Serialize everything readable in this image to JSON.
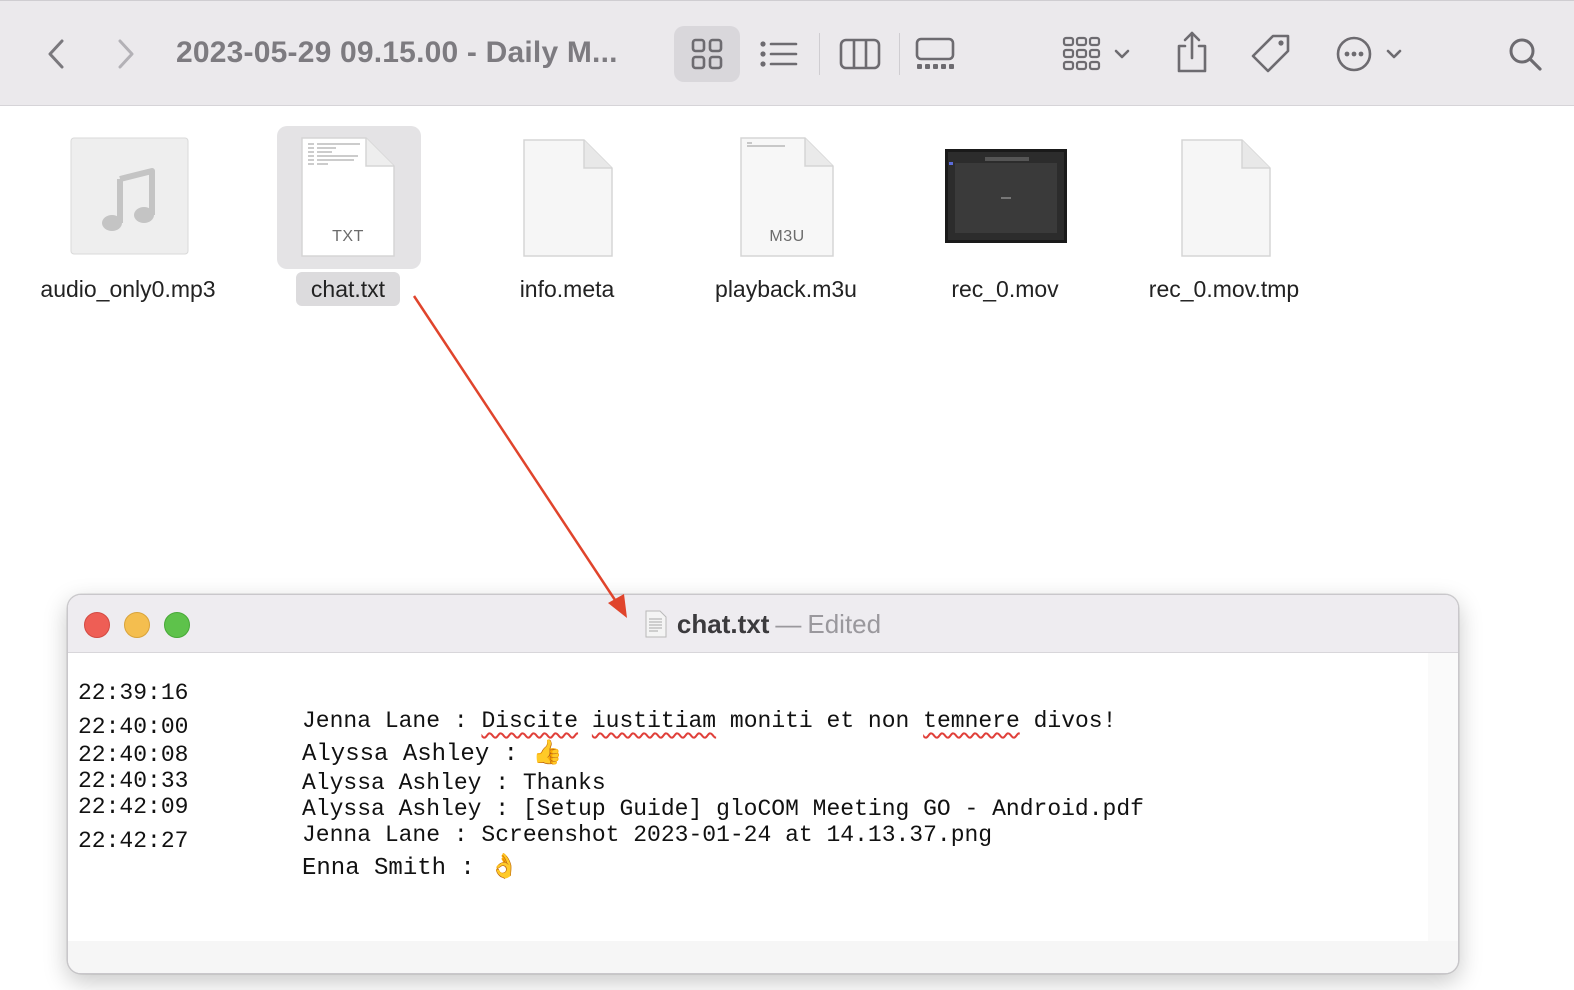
{
  "finder": {
    "window_title": "2023-05-29 09.15.00 - Daily M...",
    "files": [
      {
        "name": "audio_only0.mp3",
        "kind": "audio",
        "icon": "music-note-icon"
      },
      {
        "name": "chat.txt",
        "kind": "text",
        "badge": "TXT",
        "selected": true
      },
      {
        "name": "info.meta",
        "kind": "generic"
      },
      {
        "name": "playback.m3u",
        "kind": "playlist",
        "badge": "M3U"
      },
      {
        "name": "rec_0.mov",
        "kind": "video"
      },
      {
        "name": "rec_0.mov.tmp",
        "kind": "generic"
      }
    ],
    "toolbar_icons": [
      "chevron-left-icon",
      "chevron-right-icon",
      "grid-view-icon",
      "list-view-icon",
      "column-view-icon",
      "gallery-view-icon",
      "group-icon",
      "share-icon",
      "tag-icon",
      "more-icon",
      "search-icon"
    ]
  },
  "editor": {
    "file_name": "chat.txt",
    "separator": "—",
    "status": "Edited",
    "lines": [
      {
        "time": "22:39:16",
        "text": "Jenna Lane : Discite iustitiam moniti et non temnere divos!"
      },
      {
        "time": "22:40:00",
        "text": "Alyssa Ashley : 👍"
      },
      {
        "time": "22:40:08",
        "text": "Alyssa Ashley : Thanks"
      },
      {
        "time": "22:40:33",
        "text": "Alyssa Ashley : [Setup Guide] gloCOM Meeting GO - Android.pdf"
      },
      {
        "time": "22:42:09",
        "text": "Jenna Lane : Screenshot 2023-01-24 at 14.13.37.png"
      },
      {
        "time": "22:42:27",
        "text": "Enna Smith : 👌"
      }
    ]
  },
  "colors": {
    "annotation_arrow": "#e0442c",
    "close": "#ee5e55",
    "minimize": "#f4be4f",
    "zoom": "#5ec24b"
  }
}
